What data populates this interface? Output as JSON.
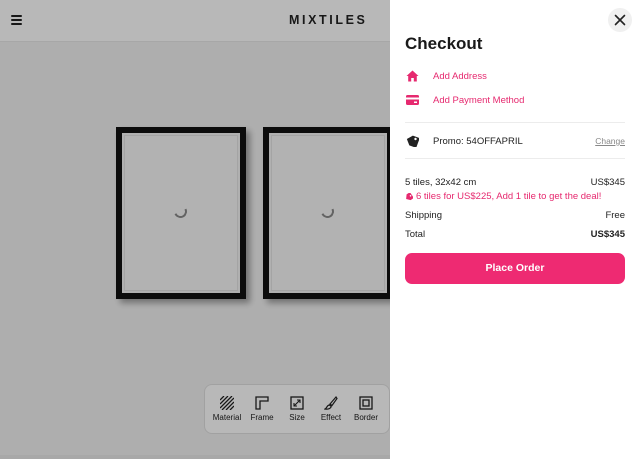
{
  "header": {
    "logo": "MIXTILES",
    "menu_icon": "hamburger-menu-icon"
  },
  "canvas": {
    "tiles": [
      {
        "loading_icon": "spinner-icon"
      },
      {
        "loading_icon": "spinner-icon"
      }
    ]
  },
  "toolbar": {
    "items": [
      {
        "label": "Material",
        "icon": "material-hatch-icon"
      },
      {
        "label": "Frame",
        "icon": "frame-corner-icon"
      },
      {
        "label": "Size",
        "icon": "size-resize-icon"
      },
      {
        "label": "Effect",
        "icon": "brush-icon"
      },
      {
        "label": "Border",
        "icon": "border-square-icon"
      }
    ]
  },
  "checkout": {
    "title": "Checkout",
    "close_icon": "close-icon",
    "add_address": "Add Address",
    "add_payment": "Add Payment Method",
    "promo_label": "Promo: 54OFFAPRIL",
    "change_link": "Change",
    "summary": {
      "tiles_label": "5 tiles, 32x42 cm",
      "tiles_price": "US$345",
      "deal_text": "6 tiles for US$225, Add 1 tile to get the deal!",
      "shipping_label": "Shipping",
      "shipping_value": "Free",
      "total_label": "Total",
      "total_value": "US$345"
    },
    "place_order": "Place Order"
  },
  "colors": {
    "accent": "#ee2a72",
    "link": "#e6296f",
    "text": "#1a1a1a"
  }
}
